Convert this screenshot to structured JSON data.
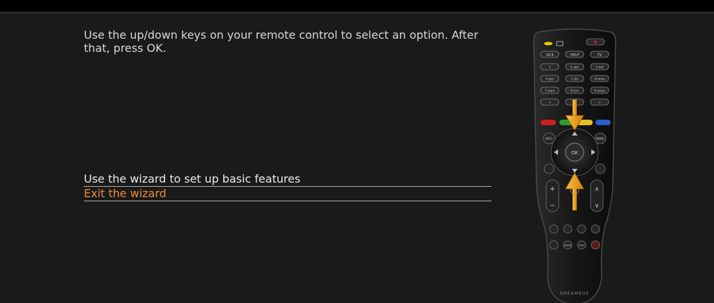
{
  "instruction": "Use the up/down keys on your remote control to select an option. After that, press OK.",
  "menu": {
    "items": [
      {
        "label": "Use the wizard to set up basic features",
        "selected": false
      },
      {
        "label": "Exit the wizard",
        "selected": true
      }
    ]
  },
  "remote": {
    "keys": {
      "help": "HELP",
      "tv": "TV",
      "digits": [
        "1",
        "2 abc",
        "3 def",
        "4 ghi",
        "5 jkl",
        "6 mno",
        "7 pqrs",
        "8 tuv",
        "9 wxyz",
        "<",
        "0",
        ">"
      ],
      "info": "INFO",
      "menu": "MENU",
      "ok": "OK",
      "audio": "AUDIO",
      "text": "TEXT",
      "brand": "DREAMBOX"
    },
    "color_keys": [
      "#cc2020",
      "#2e9e2e",
      "#e0c020",
      "#2a5ec8"
    ],
    "arrow_color": "#f0a020"
  },
  "colors": {
    "background": "#1a1a1a",
    "text": "#d8d8d8",
    "selected": "#ef8a3a",
    "separator": "#b0b0b0"
  }
}
